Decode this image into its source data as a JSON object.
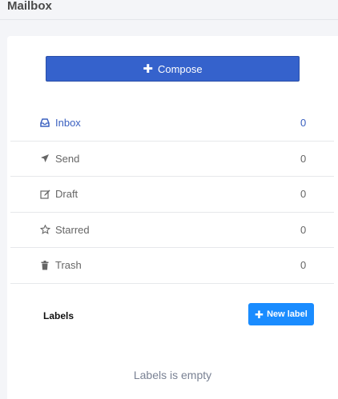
{
  "page": {
    "title": "Mailbox"
  },
  "compose": {
    "label": "Compose",
    "icon": "plus-icon"
  },
  "folders": [
    {
      "label": "Inbox",
      "count": "0",
      "icon": "inbox-icon",
      "active": true
    },
    {
      "label": "Send",
      "count": "0",
      "icon": "plane-icon"
    },
    {
      "label": "Draft",
      "count": "0",
      "icon": "edit-icon"
    },
    {
      "label": "Starred",
      "count": "0",
      "icon": "star-icon"
    },
    {
      "label": "Trash",
      "count": "0",
      "icon": "trash-icon"
    }
  ],
  "labels": {
    "title": "Labels",
    "new_label": "New label",
    "empty_message": "Labels is empty"
  },
  "colors": {
    "primary": "#3562cc",
    "active_text": "#3a60c0",
    "new_label_bg": "#1a8cff",
    "background": "#f4f5f8"
  }
}
